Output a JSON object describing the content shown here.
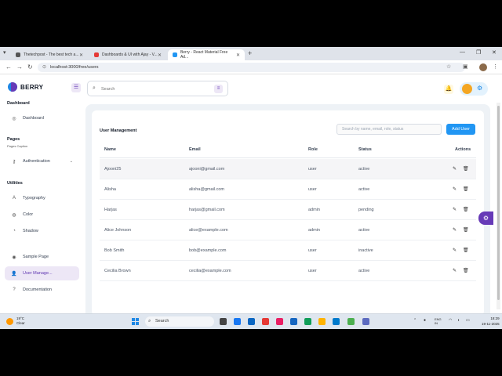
{
  "browser": {
    "tabs": [
      {
        "title": "Thetechpost - The best tech a...",
        "favicon_color": "#555555"
      },
      {
        "title": "Dashboards & UI with Ajay - V...",
        "favicon_color": "#e53935"
      },
      {
        "title": "Berry - React Material Free Ad...",
        "favicon_color": "#2196f3"
      }
    ],
    "url": "localhost:3000/free/users"
  },
  "app": {
    "brand": "BERRY",
    "search_placeholder": "Search",
    "colors": {
      "primary": "#673ab7",
      "secondary": "#2196f3"
    }
  },
  "sidebar": {
    "sections": {
      "dashboard": {
        "title": "Dashboard"
      },
      "pages": {
        "title": "Pages",
        "caption": "Pages Caption"
      },
      "utilities": {
        "title": "Utilities"
      }
    },
    "items": {
      "dashboard": {
        "label": "Dashboard",
        "icon": "dashboard-icon"
      },
      "authentication": {
        "label": "Authentication",
        "icon": "key-icon"
      },
      "typography": {
        "label": "Typography",
        "icon": "typography-icon"
      },
      "color": {
        "label": "Color",
        "icon": "palette-icon"
      },
      "shadow": {
        "label": "Shadow",
        "icon": "shadow-icon"
      },
      "sample_page": {
        "label": "Sample Page",
        "icon": "brand-chrome-icon"
      },
      "user_manage": {
        "label": "User Manage...",
        "icon": "users-icon",
        "active": true
      },
      "documentation": {
        "label": "Documentation",
        "icon": "help-icon"
      }
    }
  },
  "main": {
    "title": "User Management",
    "table_search_placeholder": "Search by name, email, role, status",
    "add_button": "Add User",
    "columns": {
      "name": "Name",
      "email": "Email",
      "role": "Role",
      "status": "Status",
      "actions": "Actions"
    },
    "rows": [
      {
        "name": "Ajooni25",
        "email": "ajooni@gmail.com",
        "role": "user",
        "status": "active"
      },
      {
        "name": "Alisha",
        "email": "alisha@gmail.com",
        "role": "user",
        "status": "active"
      },
      {
        "name": "Harjas",
        "email": "harjas@gmail.com",
        "role": "admin",
        "status": "pending"
      },
      {
        "name": "Alice Johnson",
        "email": "alice@example.com",
        "role": "admin",
        "status": "active"
      },
      {
        "name": "Bob Smith",
        "email": "bob@example.com",
        "role": "user",
        "status": "inactive"
      },
      {
        "name": "Cecilia Brown",
        "email": "cecilia@example.com",
        "role": "user",
        "status": "active"
      }
    ]
  },
  "taskbar": {
    "weather_temp": "19°C",
    "weather_text": "Clear",
    "search_label": "Search",
    "lang_line1": "ENG",
    "lang_line2": "IN",
    "time": "18:29",
    "date": "19-11-2025"
  }
}
